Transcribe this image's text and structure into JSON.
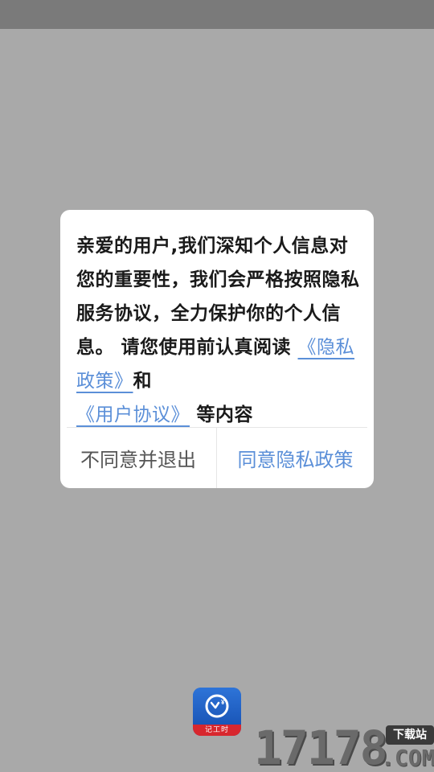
{
  "dialog": {
    "message_part1": "亲爱的用户,我们深知个人信息对您的重要性，我们会严格按照隐私服务协议，全力保护你的个人信息。 请您使用前认真阅读 ",
    "privacy_link": "《隐私政策》",
    "message_and": "和",
    "agreement_link": "《用户协议》",
    "message_part2": " 等内容",
    "decline_label": "不同意并退出",
    "accept_label": "同意隐私政策"
  },
  "app": {
    "logo_label": "记工时",
    "logo_symbol": "¥"
  },
  "watermark": {
    "digits": "17178",
    "badge": "下载站",
    "suffix": ".COM"
  },
  "colors": {
    "overlay": "#a9a9a9",
    "status_bar": "#7a7a7a",
    "link": "#5b8fd8",
    "logo_blue": "#1f5fc4",
    "logo_red": "#d8272e"
  }
}
